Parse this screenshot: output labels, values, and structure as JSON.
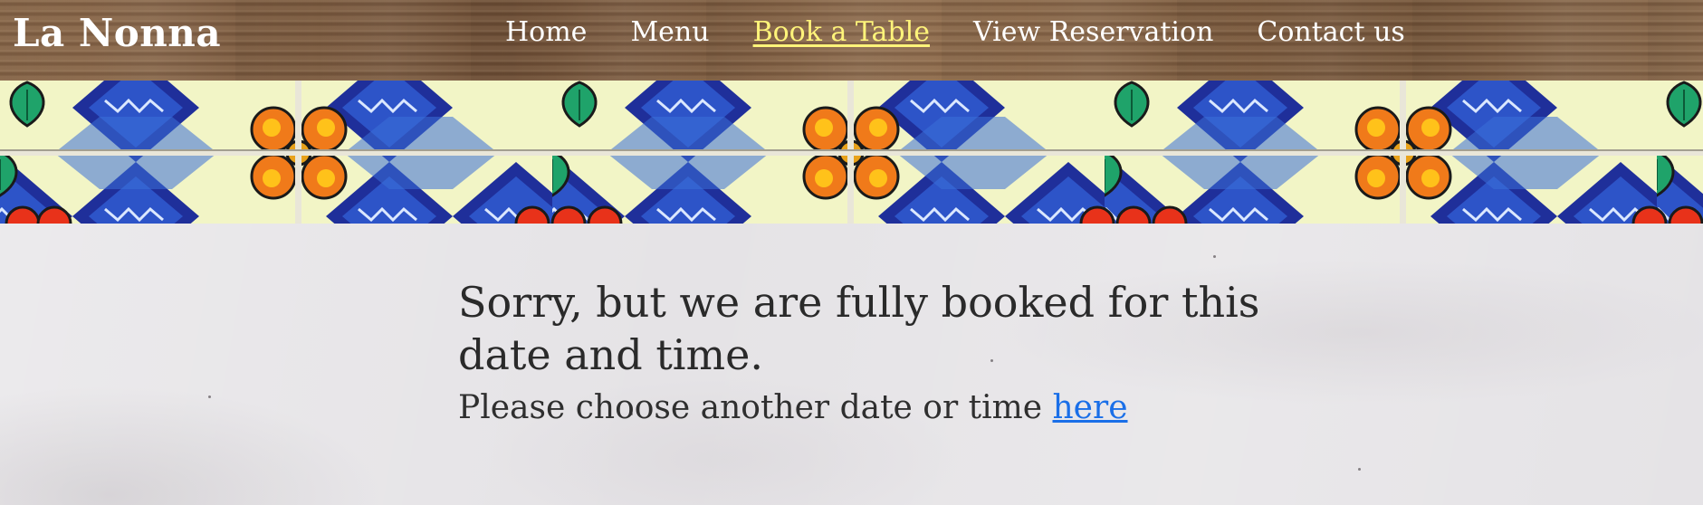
{
  "site": {
    "logo": "La Nonna"
  },
  "nav": {
    "items": [
      {
        "label": "Home",
        "active": false
      },
      {
        "label": "Menu",
        "active": false
      },
      {
        "label": "Book a Table",
        "active": true
      },
      {
        "label": "View Reservation",
        "active": false
      },
      {
        "label": "Contact us",
        "active": false
      }
    ]
  },
  "main": {
    "heading": "Sorry, but we are fully booked for this date and time.",
    "message_prefix": "Please choose another date or time",
    "link_label": "here"
  },
  "colors": {
    "nav_text": "#ffffff",
    "nav_active": "#fff47a",
    "link": "#1a6fe8",
    "heading": "#2a2a2a"
  }
}
